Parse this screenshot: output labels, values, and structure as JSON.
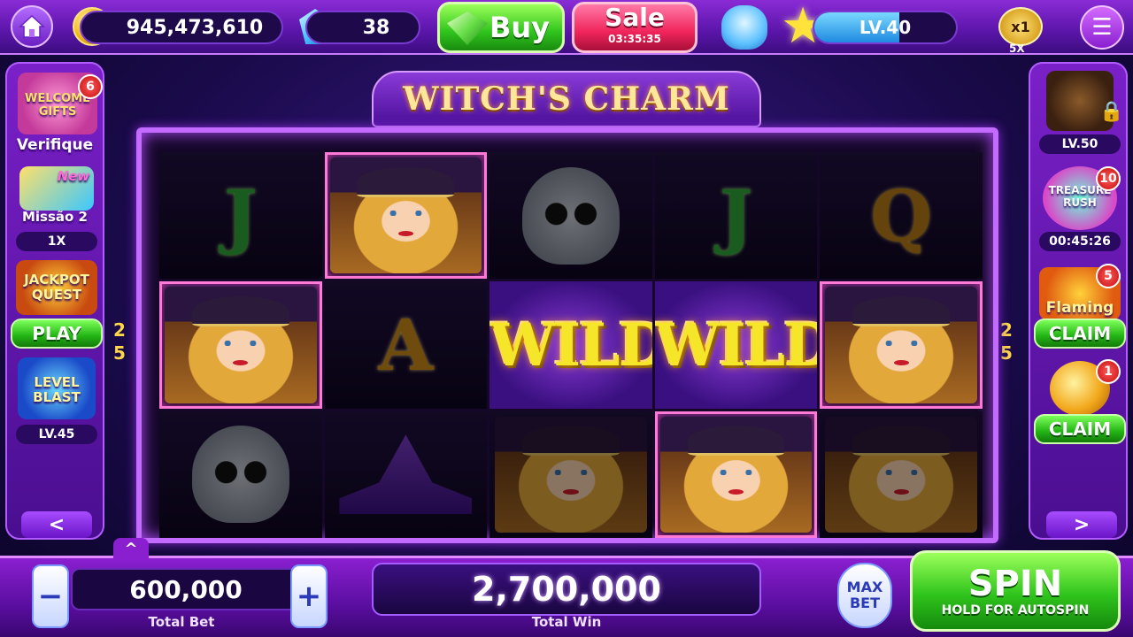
{
  "topbar": {
    "coins": "945,473,610",
    "gems": "38",
    "buy_label": "Buy",
    "sale_label": "Sale",
    "sale_timer": "03:35:35",
    "level_label": "LV.40",
    "level_progress_fraction": 0.6,
    "multiplier": "x1",
    "multiplier_sub": "5X"
  },
  "left_panel": {
    "welcome_label": "WELCOME GIFTS",
    "welcome_badge": "6",
    "welcome_caption": "Verifique",
    "mission_new": "New",
    "mission_label": "Missão 2",
    "mission_value": "1X",
    "jackpot_label": "JACKPOT QUEST",
    "jackpot_button": "PLAY",
    "level_blast_label": "LEVEL BLAST",
    "level_blast_value": "LV.45",
    "arrow": "<",
    "paylines": [
      "2",
      "5"
    ]
  },
  "right_panel": {
    "locked_level": "LV.50",
    "rush_badge": "10",
    "rush_label": "TREASURE RUSH",
    "rush_timer": "00:45:26",
    "flaming_badge": "5",
    "flaming_label": "Flaming",
    "flaming_button": "CLAIM",
    "coin_badge": "1",
    "coin_button": "CLAIM",
    "arrow": ">",
    "paylines": [
      "2",
      "5"
    ]
  },
  "game": {
    "title": "WITCH'S CHARM",
    "reels": [
      [
        "J",
        "witch",
        "skull",
        "J",
        "Q"
      ],
      [
        "witch",
        "A",
        "WILD",
        "WILD",
        "witch"
      ],
      [
        "skull",
        "hat",
        "witch",
        "witch",
        "witch"
      ]
    ],
    "wild_text": "WILD"
  },
  "bottombar": {
    "collapse_arrow": "^",
    "minus_label": "−",
    "plus_label": "+",
    "total_bet": "600,000",
    "total_bet_caption": "Total Bet",
    "total_win": "2,700,000",
    "total_win_caption": "Total Win",
    "max_bet_line1": "MAX",
    "max_bet_line2": "BET",
    "spin_label": "SPIN",
    "spin_sub": "HOLD FOR AUTOSPIN"
  }
}
